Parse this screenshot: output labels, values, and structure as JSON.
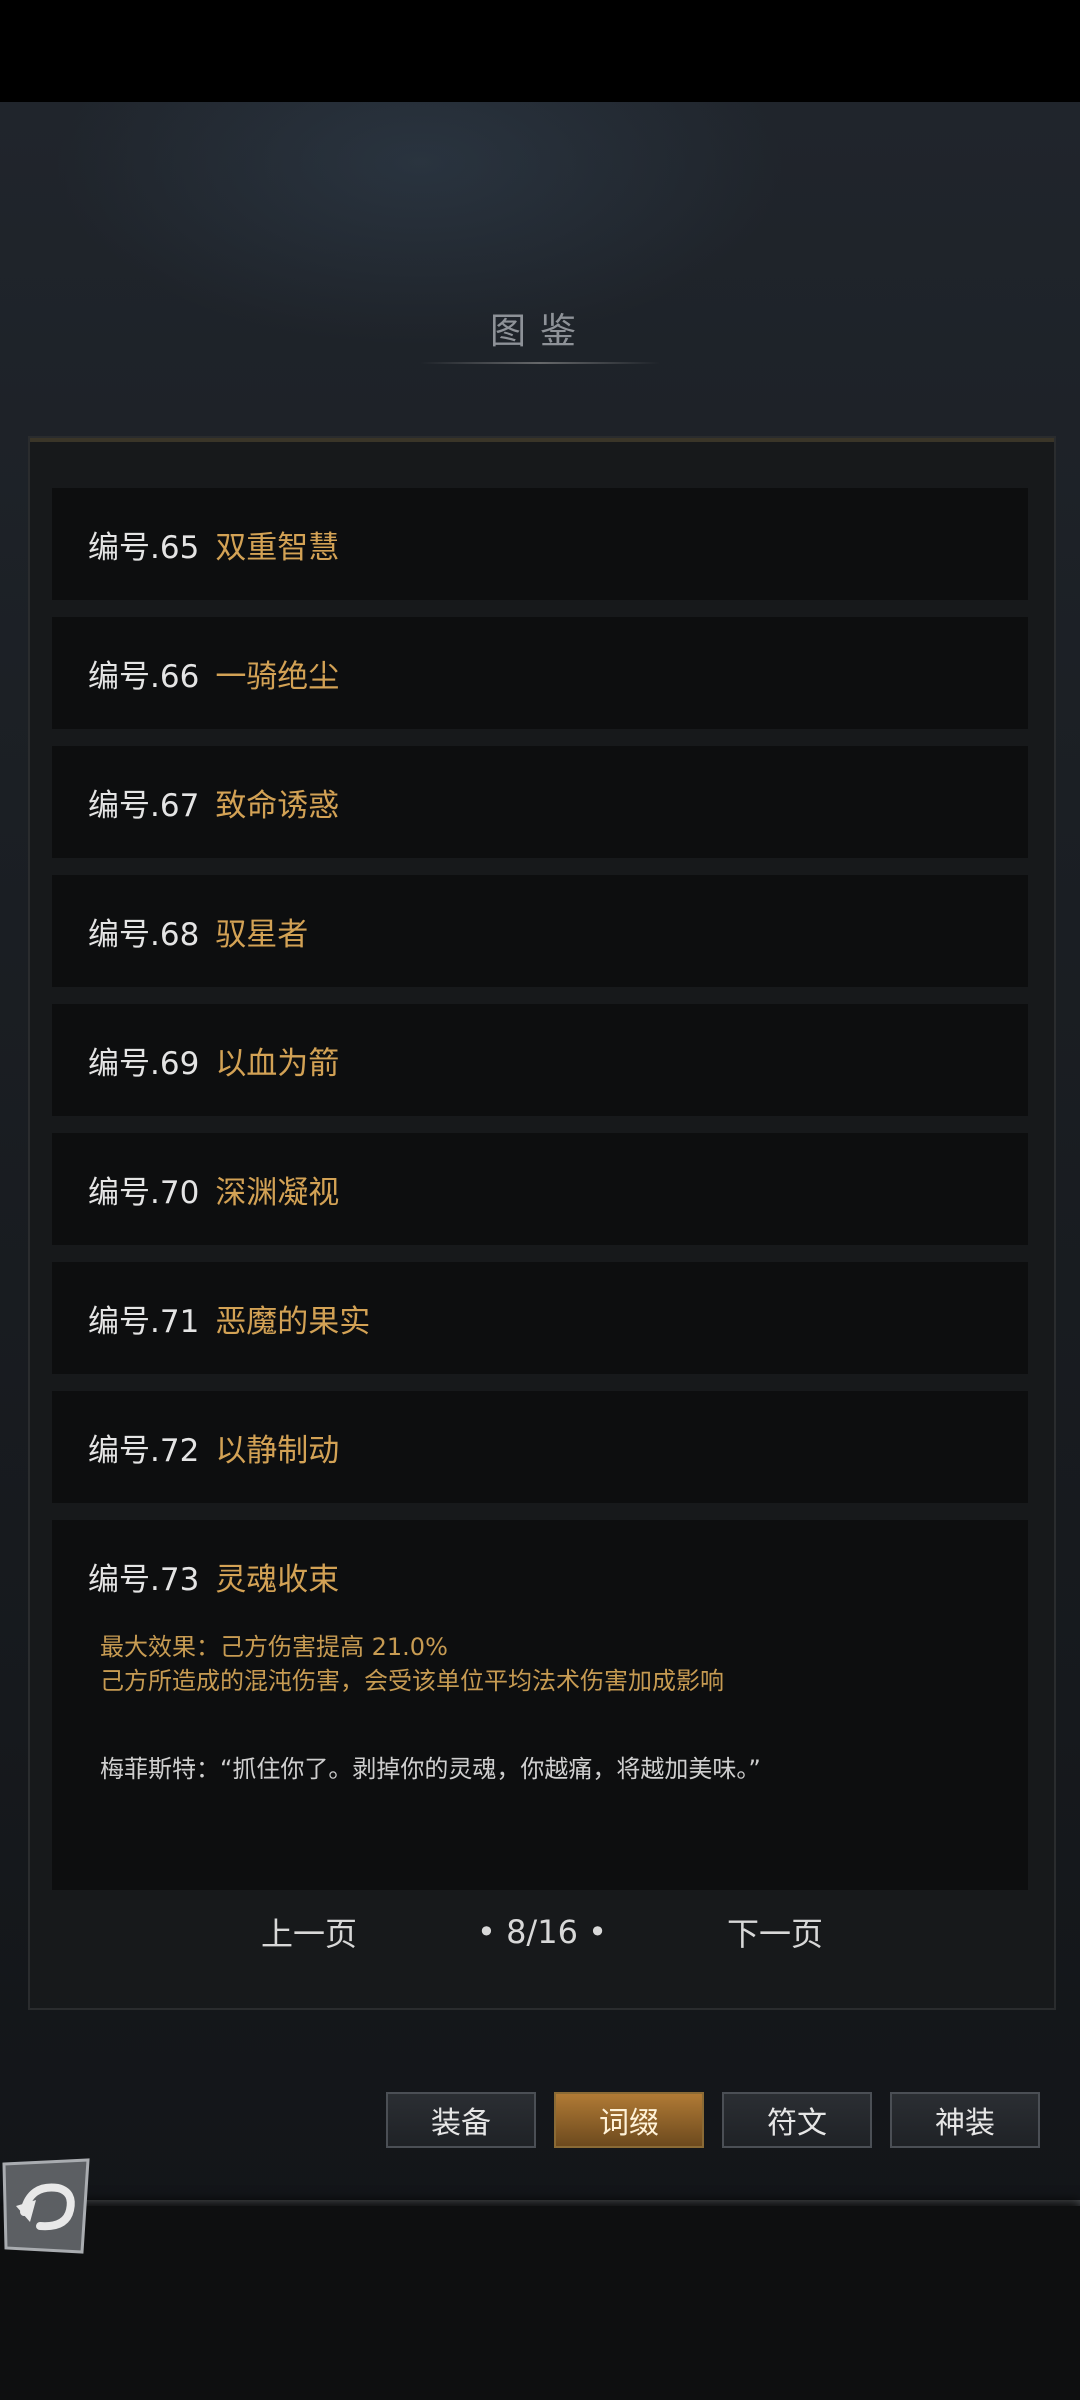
{
  "title": "图鉴",
  "entries": [
    {
      "num": "编号.65",
      "name": "双重智慧"
    },
    {
      "num": "编号.66",
      "name": "一骑绝尘"
    },
    {
      "num": "编号.67",
      "name": "致命诱惑"
    },
    {
      "num": "编号.68",
      "name": "驭星者"
    },
    {
      "num": "编号.69",
      "name": "以血为箭"
    },
    {
      "num": "编号.70",
      "name": "深渊凝视"
    },
    {
      "num": "编号.71",
      "name": "恶魔的果实"
    },
    {
      "num": "编号.72",
      "name": "以静制动"
    }
  ],
  "expanded": {
    "num": "编号.73",
    "name": "灵魂收束",
    "effect_line1": "最大效果：己方伤害提高 21.0%",
    "effect_line2": "己方所造成的混沌伤害，会受该单位平均法术伤害加成影响",
    "quote": "梅菲斯特：“抓住你了。剥掉你的灵魂，你越痛，将越加美味。”"
  },
  "pager": {
    "prev": "上一页",
    "page": "• 8/16 •",
    "next": "下一页"
  },
  "tabs": [
    "装备",
    "词缀",
    "符文",
    "神装"
  ],
  "active_tab": "词缀",
  "colors": {
    "accent": "#d3a255",
    "row_bg": "#0d0e0f",
    "tab_active": "#b07a35"
  }
}
